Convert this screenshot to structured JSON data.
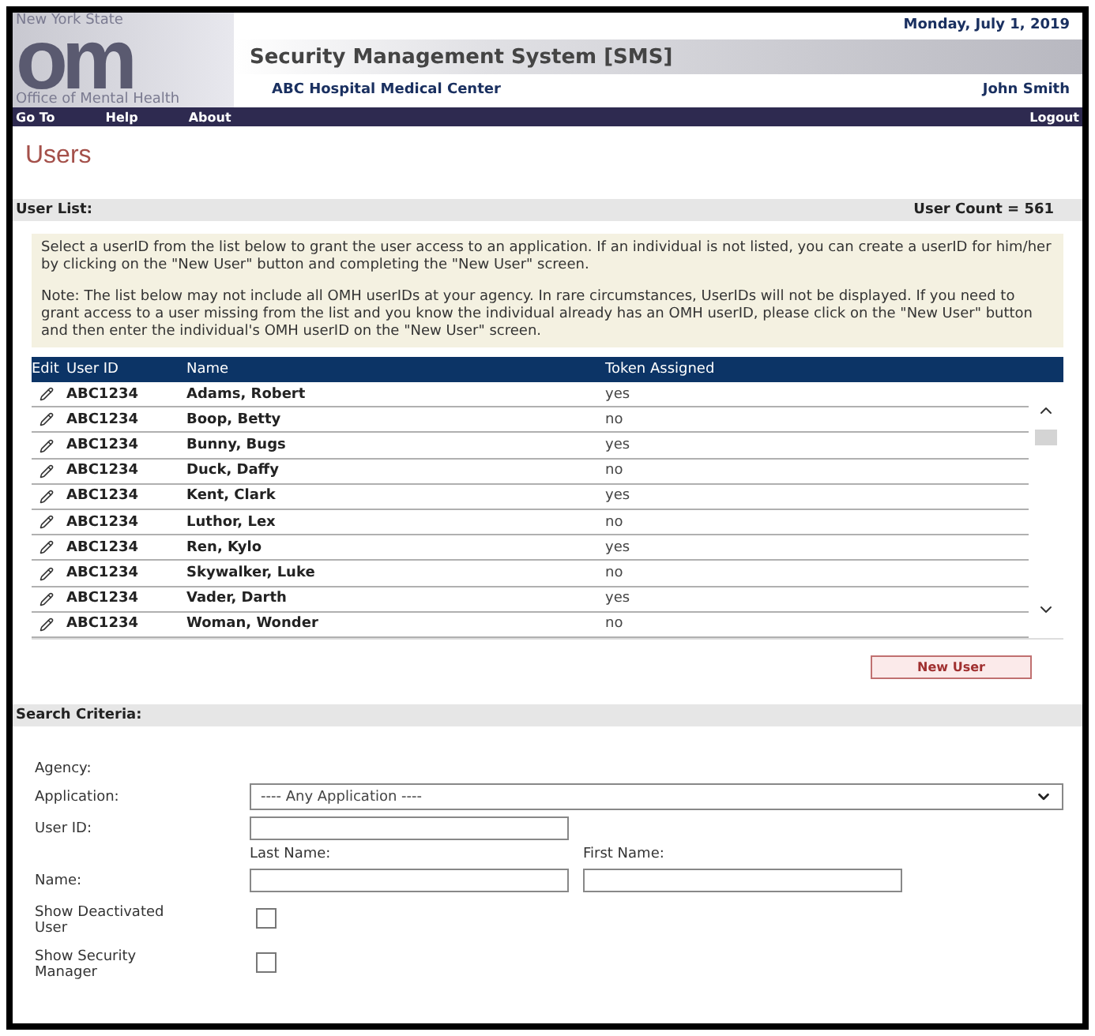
{
  "header": {
    "logo": {
      "top": "New York State",
      "letters": "om",
      "bottom": "Office of Mental Health"
    },
    "date": "Monday, July 1, 2019",
    "system_title": "Security Management System [SMS]",
    "facility": "ABC Hospital Medical Center",
    "user": "John Smith"
  },
  "nav": {
    "items": [
      "Go To",
      "Help",
      "About"
    ],
    "logout": "Logout"
  },
  "page_title": "Users",
  "user_list": {
    "label": "User List:",
    "count": "User Count = 561",
    "notes": [
      "Select a userID from the list below to grant the user access to an application. If an individual is not listed, you can create a userID for him/her by clicking on the \"New User\" button and completing the \"New User\" screen.",
      "Note:  The list below may not include all OMH userIDs at your agency.  In rare circumstances, UserIDs will not be displayed.  If you need to grant access to a user missing from the list and you know the individual already has an OMH userID, please click on the \"New User\" button and then enter the individual's OMH userID on the \"New User\" screen."
    ],
    "columns": [
      "Edit",
      "User ID",
      "Name",
      "Token Assigned"
    ],
    "rows": [
      {
        "user_id": "ABC1234",
        "name": "Adams, Robert",
        "token": "yes"
      },
      {
        "user_id": "ABC1234",
        "name": "Boop, Betty",
        "token": "no"
      },
      {
        "user_id": "ABC1234",
        "name": "Bunny, Bugs",
        "token": "yes"
      },
      {
        "user_id": "ABC1234",
        "name": "Duck, Daffy",
        "token": "no"
      },
      {
        "user_id": "ABC1234",
        "name": "Kent, Clark",
        "token": "yes"
      },
      {
        "user_id": "ABC1234",
        "name": "Luthor, Lex",
        "token": "no"
      },
      {
        "user_id": "ABC1234",
        "name": "Ren, Kylo",
        "token": "yes"
      },
      {
        "user_id": "ABC1234",
        "name": "Skywalker, Luke",
        "token": "no"
      },
      {
        "user_id": "ABC1234",
        "name": "Vader, Darth",
        "token": "yes"
      },
      {
        "user_id": "ABC1234",
        "name": "Woman, Wonder",
        "token": "no"
      }
    ],
    "new_user_button": "New User"
  },
  "search": {
    "label": "Search Criteria:",
    "agency_label": "Agency:",
    "application_label": "Application:",
    "application_value": "---- Any Application ----",
    "user_id_label": "User ID:",
    "last_name_label": "Last Name:",
    "first_name_label": "First Name:",
    "name_label": "Name:",
    "checkboxes": [
      {
        "label": "Show Deactivated User",
        "checked": false
      },
      {
        "label": "Show Security Manager",
        "checked": false
      }
    ]
  }
}
